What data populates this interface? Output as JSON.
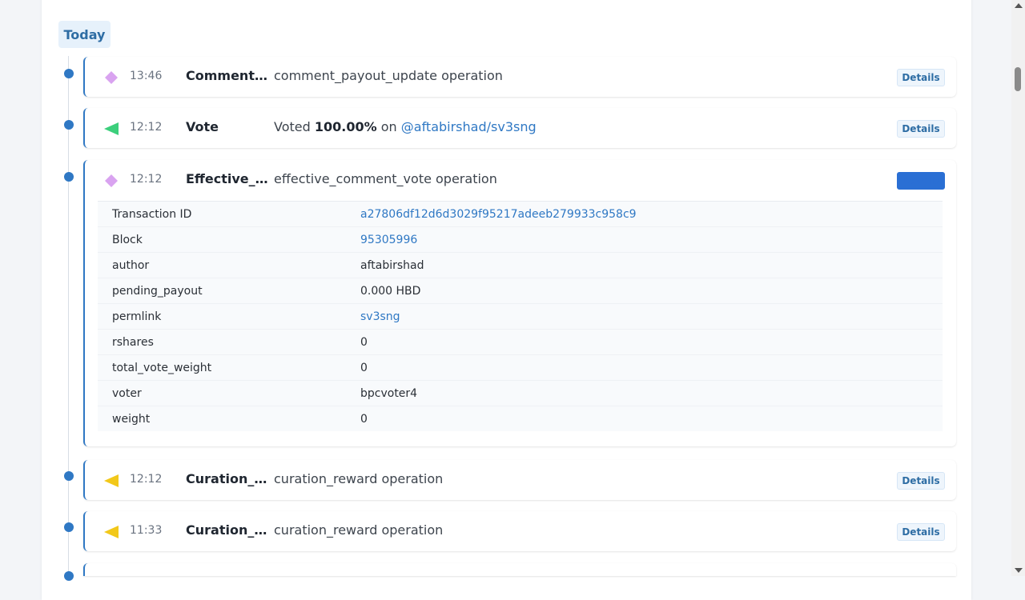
{
  "day_label": "Today",
  "details_label": "Details",
  "colors": {
    "accent": "#2f78c4",
    "comment_icon": "#d9a3f0",
    "vote_icon": "#3ccf7c",
    "curation_icon": "#f2c81a"
  },
  "operations": [
    {
      "icon": "diamond-icon",
      "time": "13:46",
      "type": "Comment_...",
      "description": "comment_payout_update operation"
    },
    {
      "icon": "vote-triangle-icon",
      "time": "12:12",
      "type": "Vote",
      "desc_prefix": "Voted",
      "desc_percent": "100.00%",
      "desc_on": "on",
      "desc_link": "@aftabirshad/sv3sng"
    },
    {
      "icon": "diamond-icon",
      "time": "12:12",
      "type": "Effective_c...",
      "description": "effective_comment_vote operation",
      "details": [
        {
          "key": "Transaction ID",
          "value": "a27806df12d6d3029f95217adeeb279933c958c9"
        },
        {
          "key": "Block",
          "value": "95305996"
        },
        {
          "key": "author",
          "value": "aftabirshad"
        },
        {
          "key": "pending_payout",
          "value": "0.000 HBD"
        },
        {
          "key": "permlink",
          "value": "sv3sng"
        },
        {
          "key": "rshares",
          "value": "0"
        },
        {
          "key": "total_vote_weight",
          "value": "0"
        },
        {
          "key": "voter",
          "value": "bpcvoter4"
        },
        {
          "key": "weight",
          "value": "0"
        }
      ]
    },
    {
      "icon": "curation-triangle-icon",
      "time": "12:12",
      "type": "Curation_re...",
      "description": "curation_reward operation"
    },
    {
      "icon": "curation-triangle-icon",
      "time": "11:33",
      "type": "Curation_re...",
      "description": "curation_reward operation"
    }
  ]
}
